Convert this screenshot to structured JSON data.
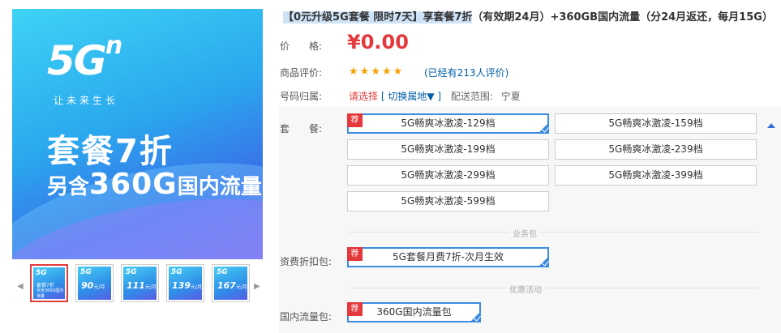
{
  "main_image": {
    "logo": "5G",
    "logo_sup": "n",
    "slogan": "让未来生长",
    "promo_line1": "套餐7折",
    "promo_line2_prefix": "另含",
    "promo_line2_num": "360G",
    "promo_line2_suffix": "国内流量"
  },
  "thumbnails": [
    {
      "logo": "5G",
      "line1": "套餐7折",
      "line2": "另含360G国内流量"
    },
    {
      "logo": "5G",
      "price": "90",
      "unit": "元/月"
    },
    {
      "logo": "5G",
      "price": "111",
      "unit": "元/月"
    },
    {
      "logo": "5G",
      "price": "139",
      "unit": "元/月"
    },
    {
      "logo": "5G",
      "price": "167",
      "unit": "元/月"
    }
  ],
  "title": {
    "highlight": "【0元升级5G套餐 限时7天】享套餐7折",
    "rest": "（有效期24月）+360GB国内流量（分24月返还，每月15G）"
  },
  "price_label": "价　　格:",
  "price": "¥0.00",
  "rating_label": "商品评价:",
  "rating_stars": 5,
  "review_text": "(已经有213人评价)",
  "region_label": "号码归属:",
  "region_select": "请选择",
  "region_switch": "[ 切换属地▼ ]",
  "ship_label": "配送范围:",
  "ship_value": "宁夏",
  "plan_label": "套　　餐:",
  "plans": [
    "5G畅爽冰激凌-129档",
    "5G畅爽冰激凌-159档",
    "5G畅爽冰激凌-199档",
    "5G畅爽冰激凌-239档",
    "5G畅爽冰激凌-299档",
    "5G畅爽冰激凌-399档",
    "5G畅爽冰激凌-599档"
  ],
  "rec_badge": "荐",
  "section_business": "业务包",
  "discount_label": "资费折扣包:",
  "discount_option": "5G套餐月费7折-次月生效",
  "section_offer": "优惠活动",
  "traffic_label": "国内流量包:",
  "traffic_option": "360G国内流量包",
  "colors": {
    "accent": "#e4393c",
    "select_blue": "#3b8be0",
    "link": "#005ea7"
  }
}
